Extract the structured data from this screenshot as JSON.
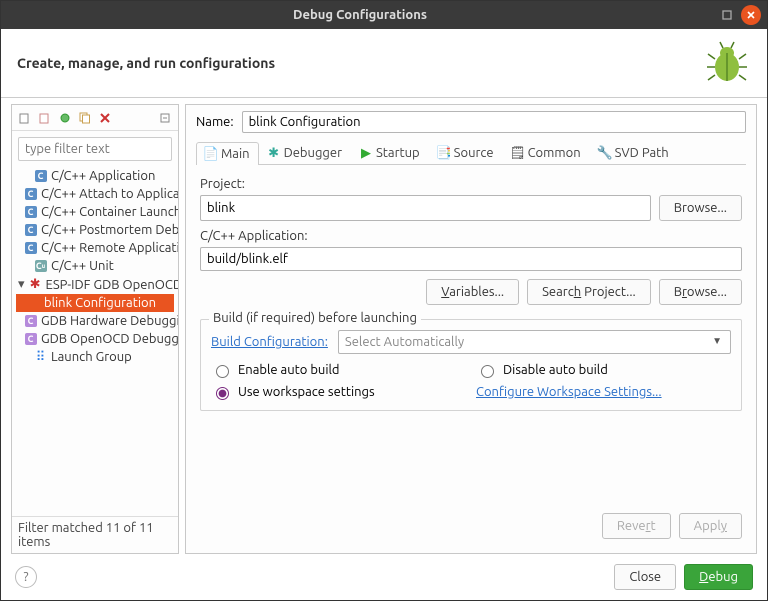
{
  "titlebar": {
    "title": "Debug Configurations"
  },
  "header": {
    "title": "Create, manage, and run configurations"
  },
  "filter": {
    "placeholder": "type filter text"
  },
  "tree": {
    "items": [
      {
        "label": "C/C++ Application",
        "kind": "c"
      },
      {
        "label": "C/C++ Attach to Application",
        "kind": "c"
      },
      {
        "label": "C/C++ Container Launcher",
        "kind": "c"
      },
      {
        "label": "C/C++ Postmortem Debugger",
        "kind": "c"
      },
      {
        "label": "C/C++ Remote Application",
        "kind": "c"
      },
      {
        "label": "C/C++ Unit",
        "kind": "cu"
      }
    ],
    "esp_parent": "ESP-IDF GDB OpenOCD Debugging",
    "esp_child": "blink Configuration",
    "rest": [
      {
        "label": "GDB Hardware Debugging",
        "kind": "g"
      },
      {
        "label": "GDB OpenOCD Debugging",
        "kind": "g"
      },
      {
        "label": "Launch Group",
        "kind": "l"
      }
    ]
  },
  "status": "Filter matched 11 of 11 items",
  "right": {
    "name_label": "Name:",
    "name_value": "blink Configuration",
    "tabs": {
      "main": "Main",
      "debugger": "Debugger",
      "startup": "Startup",
      "source": "Source",
      "common": "Common",
      "svd": "SVD Path"
    },
    "project_label": "Project:",
    "project_value": "blink",
    "browse": "Browse...",
    "app_label": "C/C++ Application:",
    "app_value": "build/blink.elf",
    "variables": "Variables...",
    "search_project": "Search Project...",
    "fieldset_title": "Build (if required) before launching",
    "build_config_label": "Build Configuration:",
    "build_config_value": "Select Automatically",
    "radio_enable": "Enable auto build",
    "radio_disable": "Disable auto build",
    "radio_workspace": "Use workspace settings",
    "configure_link": "Configure Workspace Settings...",
    "revert": "Revert",
    "apply": "Apply"
  },
  "bottom": {
    "close": "Close",
    "debug": "Debug"
  }
}
